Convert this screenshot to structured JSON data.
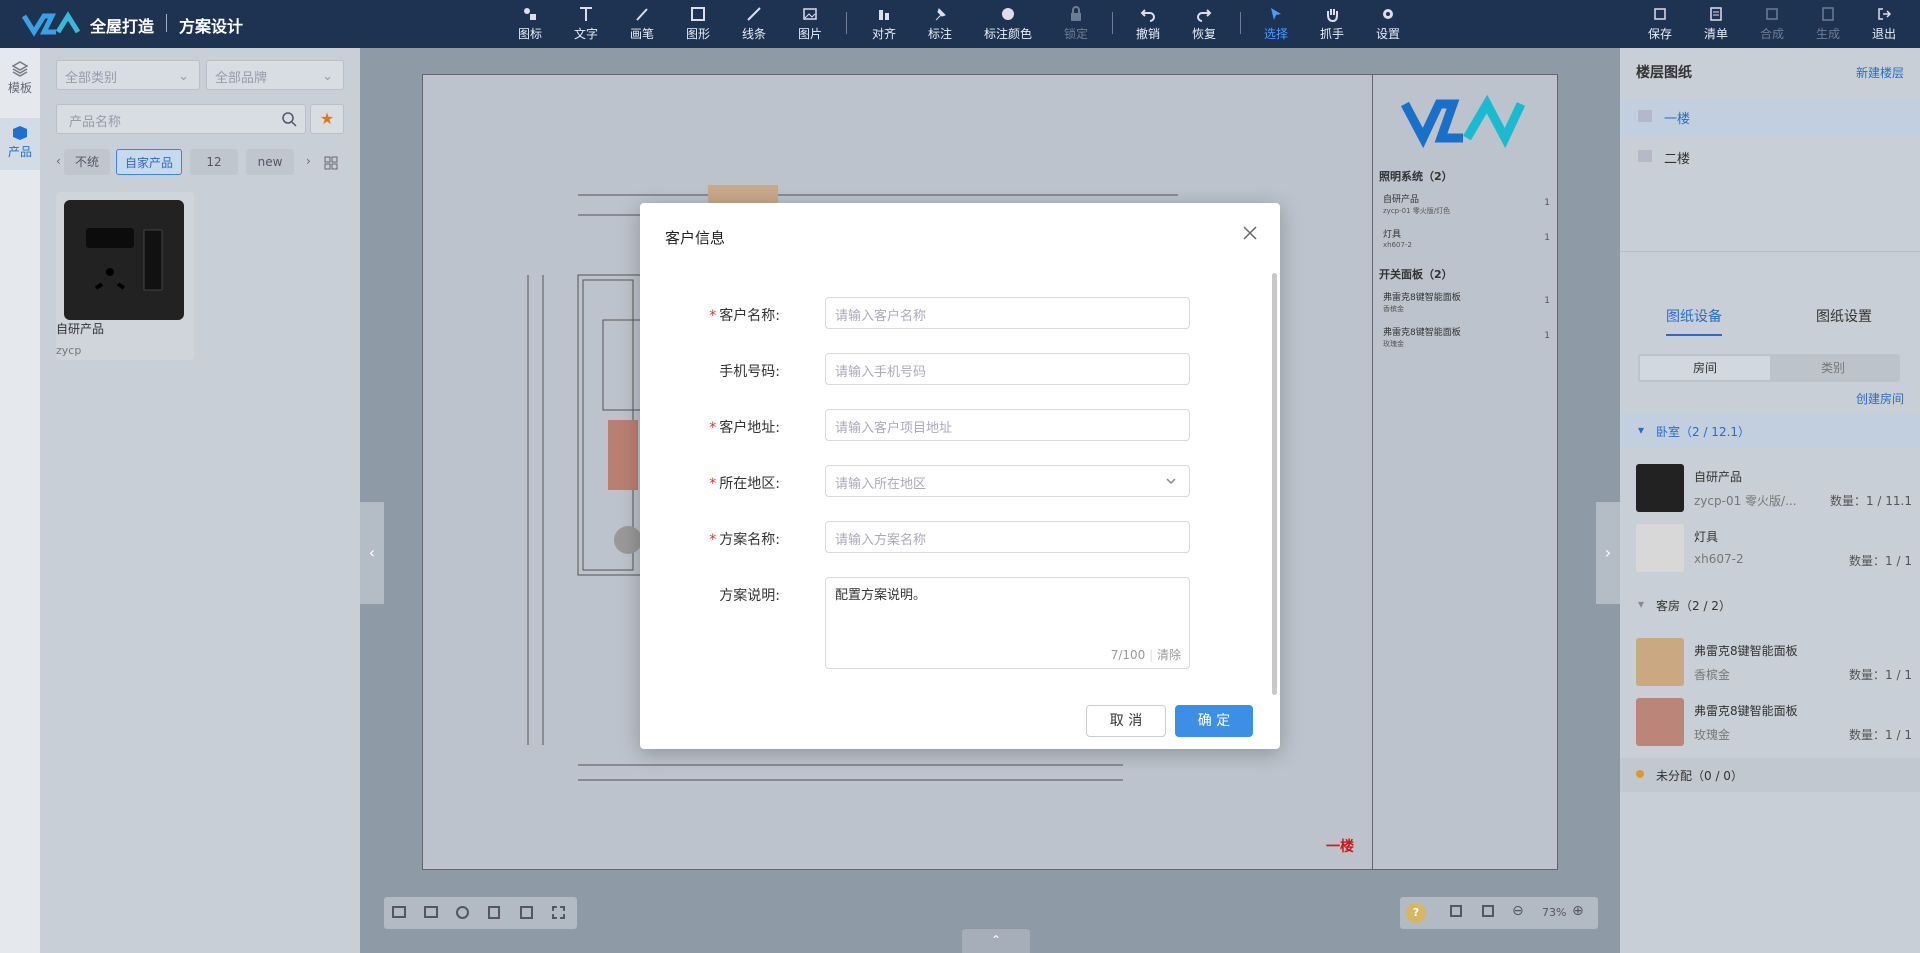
{
  "header": {
    "brand": "全屋打造",
    "subtitle": "方案设计"
  },
  "toolbar": {
    "tools": [
      "图标",
      "文字",
      "画笔",
      "图形",
      "线条",
      "图片",
      "对齐",
      "标注",
      "标注颜色",
      "锁定",
      "撤销",
      "恢复",
      "选择",
      "抓手",
      "设置"
    ],
    "right": [
      "保存",
      "清单",
      "合成",
      "生成",
      "退出"
    ]
  },
  "leftnav": {
    "items": [
      "模板",
      "产品"
    ]
  },
  "leftpanel": {
    "category_select": "全部类别",
    "brand_select": "全部品牌",
    "search_placeholder": "产品名称",
    "tags": [
      "不统",
      "自家产品",
      "12",
      "new"
    ],
    "product": {
      "name": "自研产品",
      "code": "zycp"
    }
  },
  "drawing": {
    "legend": [
      {
        "group": "照明系统（2）",
        "items": [
          {
            "name": "自研产品",
            "sub": "zycp-01 零火版/灯色",
            "count": "1"
          },
          {
            "name": "灯具",
            "sub": "xh607-2",
            "count": "1"
          }
        ]
      },
      {
        "group": "开关面板（2）",
        "items": [
          {
            "name": "弗雷克8键智能面板",
            "sub": "香槟金",
            "count": "1"
          },
          {
            "name": "弗雷克8键智能面板",
            "sub": "玫瑰金",
            "count": "1"
          }
        ]
      }
    ],
    "floor_label": "一楼",
    "zoom": "73%"
  },
  "rightpanel": {
    "title": "楼层图纸",
    "new_floor": "新建楼层",
    "floors": [
      "一楼",
      "二楼"
    ],
    "tabs": [
      "图纸设备",
      "图纸设置"
    ],
    "segments": [
      "房间",
      "类别"
    ],
    "create_room": "创建房间",
    "rooms": [
      {
        "name": "卧室（2 / 12.1）",
        "items": [
          {
            "name": "自研产品",
            "sub": "zycp-01 零火版/...",
            "qty": "数量：1 / 11.1"
          },
          {
            "name": "灯具",
            "sub": "xh607-2",
            "qty": "数量：1 / 1"
          }
        ]
      },
      {
        "name": "客房（2 / 2）",
        "items": [
          {
            "name": "弗雷克8键智能面板",
            "sub": "香槟金",
            "qty": "数量：1 / 1"
          },
          {
            "name": "弗雷克8键智能面板",
            "sub": "玫瑰金",
            "qty": "数量：1 / 1"
          }
        ]
      }
    ],
    "unassigned": "未分配（0 / 0）"
  },
  "modal": {
    "title": "客户信息",
    "fields": [
      {
        "label": "客户名称:",
        "placeholder": "请输入客户名称",
        "required": true
      },
      {
        "label": "手机号码:",
        "placeholder": "请输入手机号码",
        "required": false
      },
      {
        "label": "客户地址:",
        "placeholder": "请输入客户项目地址",
        "required": true
      },
      {
        "label": "所在地区:",
        "placeholder": "请输入所在地区",
        "required": true
      },
      {
        "label": "方案名称:",
        "placeholder": "请输入方案名称",
        "required": true
      }
    ],
    "desc_label": "方案说明:",
    "desc_value": "配置方案说明。",
    "desc_count": "7/100",
    "desc_clear": "清除",
    "cancel": "取 消",
    "ok": "确 定"
  },
  "colors": {
    "accent": "#3d8fe6",
    "header": "#1e3352",
    "required": "#e03030",
    "floor_label": "#d01818"
  }
}
